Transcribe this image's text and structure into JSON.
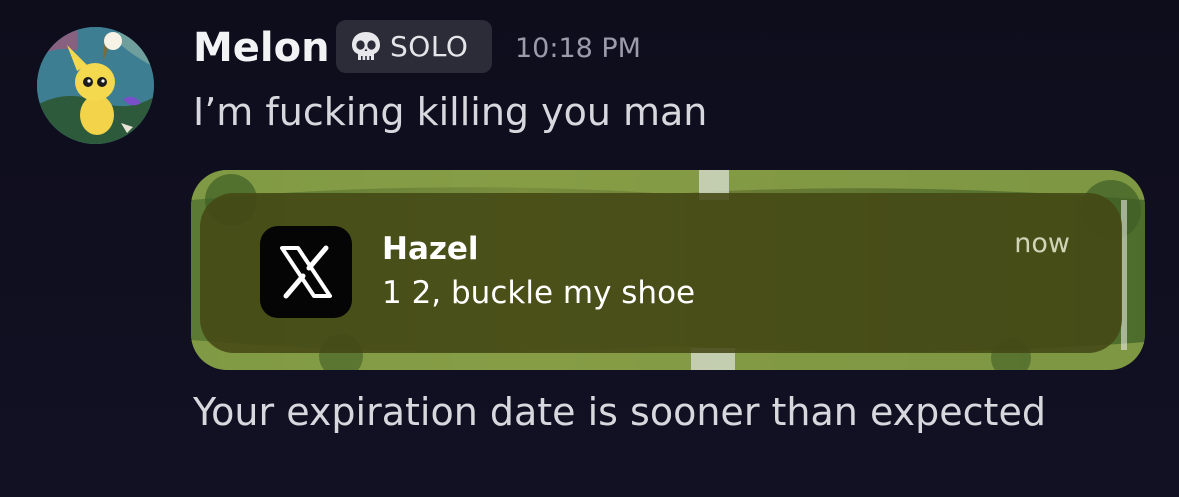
{
  "message": {
    "author": "Melon",
    "tag": {
      "icon": "skull-icon",
      "label": "SOLO"
    },
    "timestamp": "10:18 PM",
    "lines": [
      "I’m fucking killing you man",
      "Your expiration date is sooner than expected"
    ],
    "avatar_icon": "yellow-pikmin-avatar"
  },
  "embed": {
    "notification": {
      "app_icon": "x-logo-icon",
      "title": "Hazel",
      "body": "1 2, buckle my shoe",
      "time": "now"
    }
  },
  "colors": {
    "background": "#0f0f1e",
    "username": "#f2f3f5",
    "message_text": "#d7d8de",
    "timestamp": "#9a9caa",
    "tag_background": "#2b2c38",
    "notification_background": "#44481a",
    "x_icon_background": "#050505"
  }
}
